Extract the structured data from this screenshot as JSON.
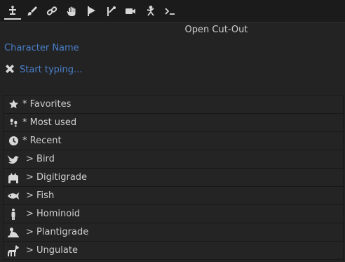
{
  "toolbar": {
    "tools": [
      {
        "icon": "rig-tool-icon",
        "active": true
      },
      {
        "icon": "brush-icon",
        "active": false
      },
      {
        "icon": "link-icon",
        "active": false
      },
      {
        "icon": "hand-icon",
        "active": false
      },
      {
        "icon": "play-flag-icon",
        "active": false
      },
      {
        "icon": "bone-branch-icon",
        "active": false
      },
      {
        "icon": "camera-icon",
        "active": false
      },
      {
        "icon": "pose-icon",
        "active": false
      },
      {
        "icon": "console-icon",
        "active": false
      }
    ]
  },
  "header": {
    "title": "Open Cut-Out"
  },
  "form": {
    "character_name_label": "Character Name",
    "search_placeholder": "Start typing...",
    "clear_icon": "close-x-icon"
  },
  "list": {
    "items": [
      {
        "label": "* Favorites",
        "icon": "star-icon"
      },
      {
        "label": "* Most used",
        "icon": "footprints-icon"
      },
      {
        "label": "* Recent",
        "icon": "clock-icon"
      },
      {
        "label": "> Bird",
        "icon": "bird-icon"
      },
      {
        "label": "> Digitigrade",
        "icon": "cat-icon"
      },
      {
        "label": "> Fish",
        "icon": "fish-icon"
      },
      {
        "label": "> Hominoid",
        "icon": "person-icon"
      },
      {
        "label": "> Plantigrade",
        "icon": "frog-icon"
      },
      {
        "label": "> Ungulate",
        "icon": "horse-icon"
      }
    ]
  },
  "colors": {
    "background": "#232323",
    "accent_text": "#4a7fc9",
    "text": "#cfcfcf",
    "row_border": "#181818"
  }
}
